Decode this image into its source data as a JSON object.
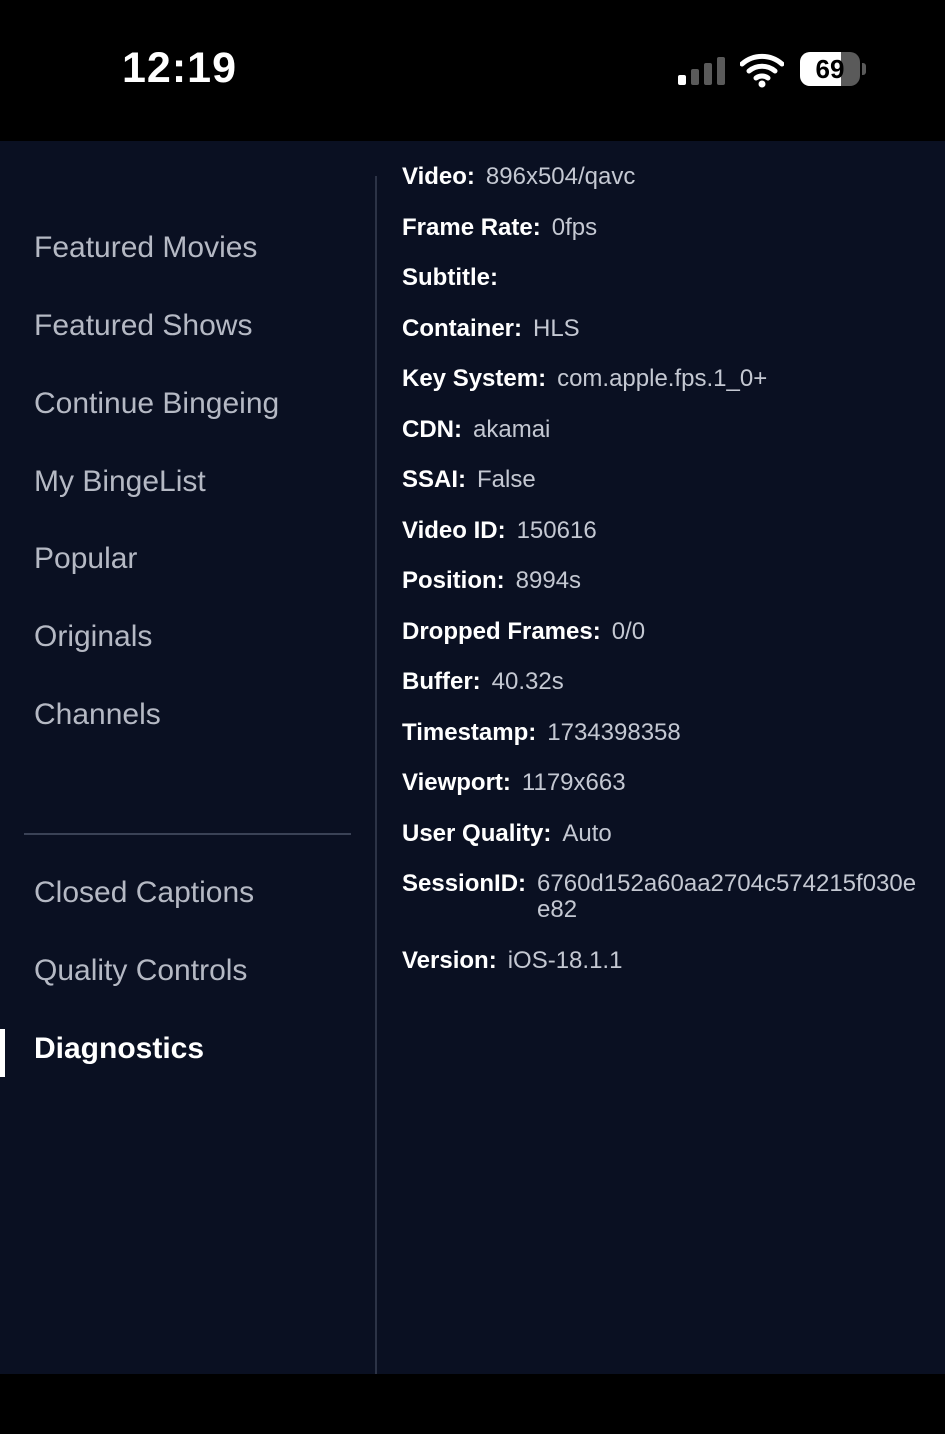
{
  "status_bar": {
    "time": "12:19",
    "battery_level": "69",
    "battery_fraction": 0.69,
    "signal_bars_active": 1,
    "signal_bars_total": 4
  },
  "sidebar": {
    "items": [
      {
        "label": "Featured Movies"
      },
      {
        "label": "Featured Shows"
      },
      {
        "label": "Continue Bingeing"
      },
      {
        "label": "My BingeList"
      },
      {
        "label": "Popular"
      },
      {
        "label": "Originals"
      },
      {
        "label": "Channels"
      }
    ],
    "settings": [
      {
        "label": "Closed Captions"
      },
      {
        "label": "Quality Controls"
      },
      {
        "label": "Diagnostics",
        "active": true
      }
    ]
  },
  "diagnostics": [
    {
      "label": "Video:",
      "value": "896x504/qavc"
    },
    {
      "label": "Frame Rate:",
      "value": "0fps"
    },
    {
      "label": "Subtitle:",
      "value": ""
    },
    {
      "label": "Container:",
      "value": "HLS"
    },
    {
      "label": "Key System:",
      "value": "com.apple.fps.1_0+"
    },
    {
      "label": "CDN:",
      "value": "akamai"
    },
    {
      "label": "SSAI:",
      "value": "False"
    },
    {
      "label": "Video ID:",
      "value": "150616"
    },
    {
      "label": "Position:",
      "value": "8994s"
    },
    {
      "label": "Dropped Frames:",
      "value": "0/0"
    },
    {
      "label": "Buffer:",
      "value": "40.32s"
    },
    {
      "label": "Timestamp:",
      "value": "1734398358"
    },
    {
      "label": "Viewport:",
      "value": "1179x663"
    },
    {
      "label": "User Quality:",
      "value": "Auto"
    },
    {
      "label": "SessionID:",
      "value": "6760d152a60aa2704c574215f030ee82"
    },
    {
      "label": "Version:",
      "value": "iOS-18.1.1"
    }
  ]
}
